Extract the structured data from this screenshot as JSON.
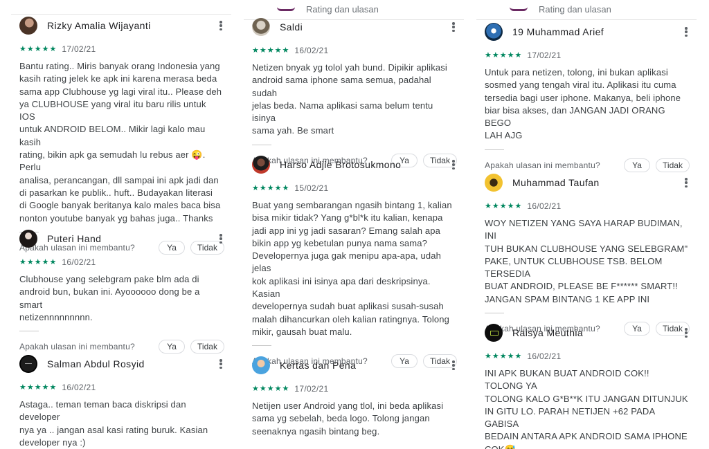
{
  "header": {
    "label": "Rating dan ulasan"
  },
  "ui": {
    "helpful_question": "Apakah ulasan ini membantu?",
    "yes_label": "Ya",
    "no_label": "Tidak",
    "star_color": "#01875f"
  },
  "columns": [
    {
      "reviews": [
        {
          "name": "Rizky Amalia Wijayanti",
          "stars": 5,
          "date": "17/02/21",
          "text": "Bantu rating.. Miris banyak orang Indonesia yang\nkasih rating jelek ke apk ini karena merasa beda\nsama app Clubhouse yg lagi viral itu.. Please deh\nya CLUBHOUSE yang viral itu baru rilis untuk IOS\nuntuk ANDROID BELOM.. Mikir lagi kalo mau kasih\nrating, bikin apk ga semudah lu rebus aer 😜. Perlu\nanalisa, perancangan, dll sampai ini apk jadi dan\ndi pasarkan ke publik.. huft.. Budayakan literasi\ndi Google banyak beritanya kalo males baca bisa\nnonton youtube banyak yg bahas juga.. Thanks"
        },
        {
          "name": "Puteri Hand",
          "stars": 5,
          "date": "16/02/21",
          "text": "Clubhouse yang selebgram pake blm ada di\nandroid bun, bukan ini. Ayoooooo dong be a smart\nnetizennnnnnnnn."
        },
        {
          "name": "Salman Abdul Rosyid",
          "stars": 5,
          "date": "16/02/21",
          "text": "Astaga.. teman teman baca diskripsi dan developer\nnya ya .. jangan asal kasi rating buruk. Kasian\ndeveloper nya :)"
        }
      ]
    },
    {
      "reviews": [
        {
          "name": "Saldi",
          "stars": 5,
          "date": "16/02/21",
          "text": "Netizen bnyak yg tolol yah bund. Dipikir aplikasi\nandroid sama iphone sama semua, padahal sudah\njelas beda. Nama aplikasi sama belum tentu isinya\nsama yah. Be smart"
        },
        {
          "name": "Harso Adjie Brotosukmono",
          "stars": 5,
          "date": "15/02/21",
          "text": "Buat yang sembarangan ngasih bintang 1, kalian\nbisa mikir tidak? Yang g*bl*k itu kalian, kenapa\njadi app ini yg jadi sasaran? Emang salah apa\nbikin app yg kebetulan punya nama sama?\nDevelopernya juga gak menipu apa-apa, udah jelas\nkok aplikasi ini isinya apa dari deskripsinya. Kasian\ndevelopernya sudah buat aplikasi susah-susah\nmalah dihancurkan oleh kalian ratingnya. Tolong\nmikir, gausah buat malu."
        },
        {
          "name": "Kertas dan Pena",
          "stars": 5,
          "date": "17/02/21",
          "text": "Netijen user Android yang tlol, ini beda aplikasi\nsama yg sebelah, beda logo. Tolong jangan\nseenaknya ngasih bintang beg."
        }
      ]
    },
    {
      "reviews": [
        {
          "name": "19 Muhammad Arief",
          "stars": 5,
          "date": "17/02/21",
          "text": "Untuk para netizen, tolong, ini bukan aplikasi\nsosmed yang tengah viral itu. Aplikasi itu cuma\ntersedia bagi user iphone. Makanya, beli iphone\nbiar bisa akses, dan JANGAN JADI ORANG BEGO\nLAH AJG"
        },
        {
          "name": "Muhammad Taufan",
          "stars": 5,
          "date": "16/02/21",
          "text": "WOY NETIZEN YANG SAYA HARAP BUDIMAN, INI\nTUH BUKAN CLUBHOUSE YANG SELEBGRAM\"\nPAKE, UNTUK CLUBHOUSE TSB. BELOM TERSEDIA\nBUAT ANDROID, PLEASE BE F****** SMART!!\nJANGAN SPAM BINTANG 1 KE APP INI"
        },
        {
          "name": "Raisya Meuthia",
          "stars": 5,
          "date": "16/02/21",
          "text": "INI APK BUKAN BUAT ANDROID COK!! TOLONG YA\nTOLONG KALO G*B**K ITU JANGAN DITUNJUK\nIN GITU LO. PARAH NETIJEN +62 PADA GABISA\nBEDAIN ANTARA APK ANDROID SAMA IPHONE\nCOK😅"
        }
      ]
    }
  ]
}
